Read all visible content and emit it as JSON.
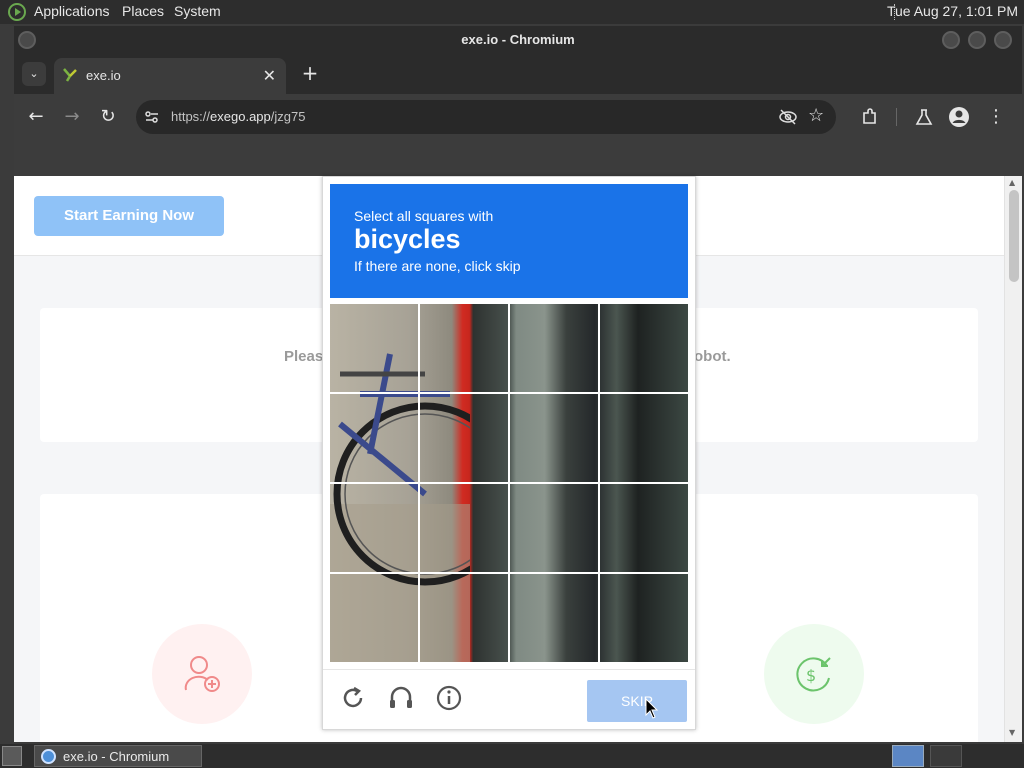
{
  "top_panel": {
    "menus": [
      "Applications",
      "Places",
      "System"
    ],
    "clock": "Tue Aug 27,  1:01 PM"
  },
  "window": {
    "title": "exe.io - Chromium"
  },
  "tab": {
    "title": "exe.io",
    "close_glyph": "✕",
    "new_tab_glyph": "+",
    "list_glyph": "⌄"
  },
  "toolbar": {
    "url_scheme": "https://",
    "url_host": "exego.app",
    "url_path": "/jzg75"
  },
  "page": {
    "earn_button": "Start Earning Now",
    "notice_left": "Pleas",
    "notice_right": "obot."
  },
  "captcha": {
    "instruction_pre": "Select all squares with",
    "target": "bicycles",
    "instruction_post": "If there are none, click skip",
    "grid_rows": 4,
    "grid_cols": 4,
    "skip_label": "SKIP"
  },
  "taskbar": {
    "window_label": "exe.io - Chromium"
  },
  "colors": {
    "captcha_blue": "#1a73e8",
    "skip_disabled": "#a5c6f2",
    "earn_button": "#8fc2f7"
  }
}
